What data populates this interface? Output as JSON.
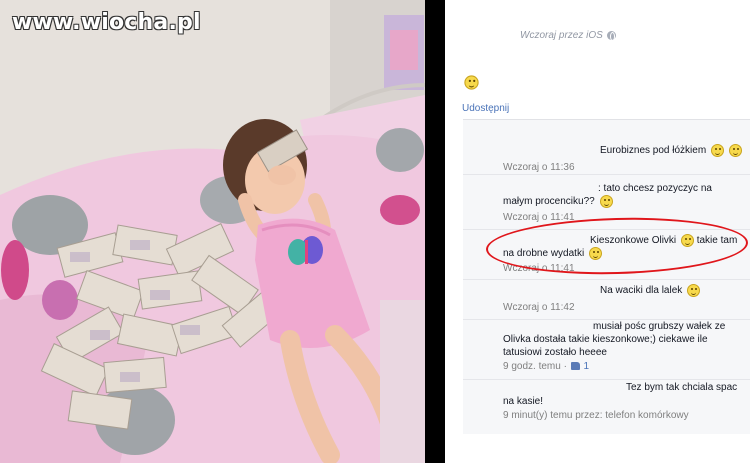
{
  "watermark": "www.wiocha.pl",
  "post": {
    "meta": "Wczoraj przez iOS",
    "emoji": "smile",
    "share": "Udostępnij"
  },
  "comments": [
    {
      "text": "Eurobiznes pod łóżkiem",
      "emoji_count": 2,
      "time": "Wczoraj o 11:36"
    },
    {
      "text_line1": ": tato chcesz pozyczyc na",
      "text_line2": "małym procenciku??",
      "emoji_count": 1,
      "time": "Wczoraj o 11:41"
    },
    {
      "text_line1": "Kieszonkowe Olivki",
      "text_line1b": "takie tam",
      "text_line2": "na drobne wydatki",
      "emoji_count": 2,
      "time": "Wczoraj o 11:41",
      "highlighted": true
    },
    {
      "text": "Na waciki dla lalek",
      "emoji_count": 1,
      "time": "Wczoraj o 11:42"
    },
    {
      "text_line1": "musiał pośc grubszy wałek ze",
      "text_line2": "Olivka dostała takie kieszonkowe;) ciekawe ile",
      "text_line3": "tatusiowi zostało heeee",
      "time": "9 godz. temu ·",
      "likes": "1"
    },
    {
      "text_line1": "Tez bym tak chciala spac",
      "text_line2": "na kasie!",
      "time": "9 minut(y) temu przez: telefon komórkowy"
    }
  ],
  "colors": {
    "link": "#4a73b8",
    "highlight": "#e0161b",
    "panel_bg": "#f6f7f9"
  }
}
